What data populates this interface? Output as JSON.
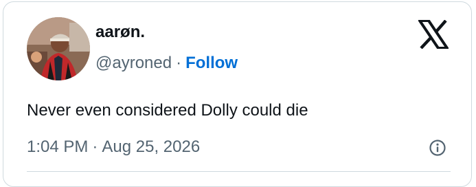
{
  "author": {
    "display_name": "aarøn.",
    "handle": "@ayroned",
    "separator": "·",
    "follow_label": "Follow"
  },
  "tweet": {
    "text": "Never even considered Dolly could die",
    "time": "1:04 PM",
    "separator": "·",
    "date": "Aug 25, 2026"
  },
  "icons": {
    "logo": "x-logo-icon",
    "info": "info-icon",
    "avatar": "profile-photo"
  },
  "colors": {
    "text_primary": "#0f1419",
    "text_secondary": "#536471",
    "link": "#006fd6",
    "border": "#cfd9de"
  }
}
